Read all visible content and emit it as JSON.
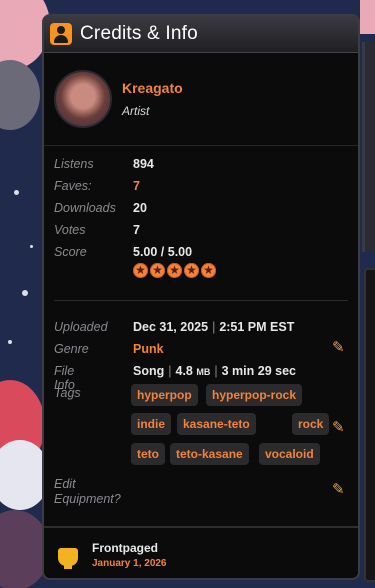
{
  "panel": {
    "title": "Credits & Info",
    "icon": "user-icon"
  },
  "artist": {
    "name": "Kreagato",
    "role": "Artist"
  },
  "stats": {
    "listens_label": "Listens",
    "listens": "894",
    "faves_label": "Faves:",
    "faves": "7",
    "downloads_label": "Downloads",
    "downloads": "20",
    "votes_label": "Votes",
    "votes": "7",
    "score_label": "Score",
    "score": "5.00 / 5.00",
    "stars": 5
  },
  "details": {
    "uploaded_label": "Uploaded",
    "uploaded_date": "Dec 31, 2025",
    "uploaded_time": "2:51 PM EST",
    "genre_label": "Genre",
    "genre": "Punk",
    "fileinfo_label": "File Info",
    "file_type": "Song",
    "file_size": "4.8",
    "file_size_unit": "MB",
    "file_length": "3 min 29 sec",
    "tags_label": "Tags",
    "tags": [
      "hyperpop",
      "hyperpop-rock",
      "indie",
      "kasane-teto",
      "rock",
      "teto",
      "teto-kasane",
      "vocaloid"
    ],
    "edit_label_1": "Edit",
    "edit_label_2": "Equipment?"
  },
  "footer": {
    "title": "Frontpaged",
    "date": "January 1, 2026"
  },
  "colors": {
    "accent": "#f2833a",
    "panel_bg": "#0b0b0c",
    "page_bg": "#1f2a4d"
  }
}
